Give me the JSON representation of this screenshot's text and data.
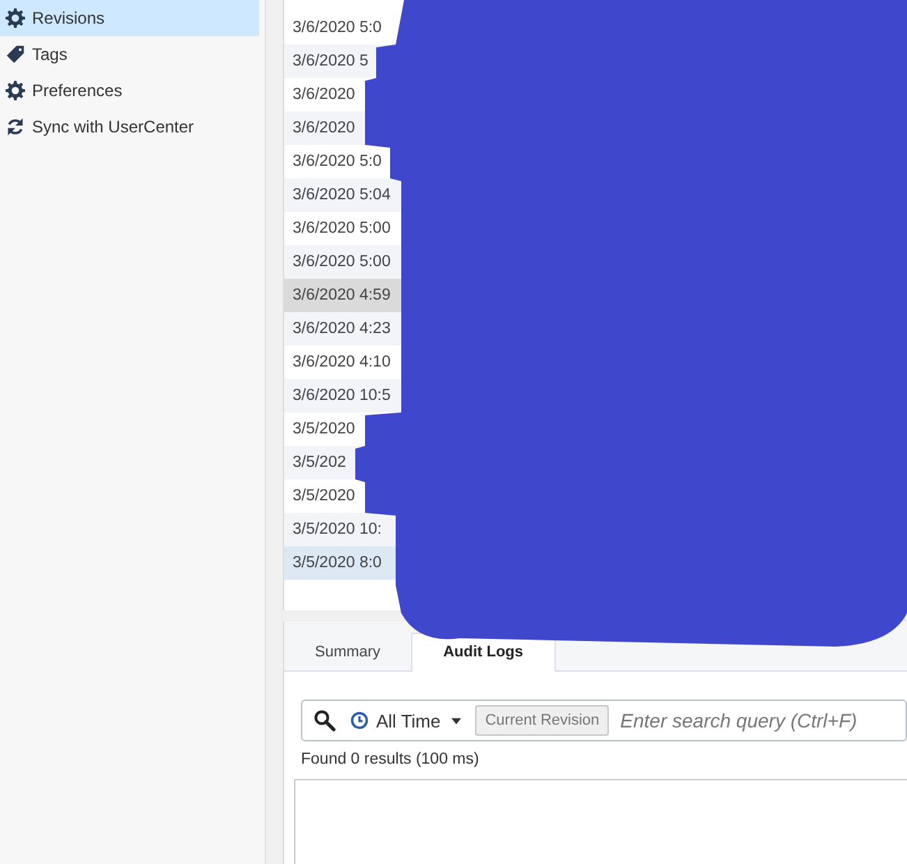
{
  "sidebar": {
    "items": [
      {
        "label": "Revisions",
        "selected": true
      },
      {
        "label": "Tags",
        "selected": false
      },
      {
        "label": "Preferences",
        "selected": false
      },
      {
        "label": "Sync with UserCenter",
        "selected": false
      }
    ]
  },
  "revisions": {
    "rows": [
      {
        "date": "3/6/2020 5:0",
        "selected": false,
        "hovered": false
      },
      {
        "date": "3/6/2020 5",
        "selected": false,
        "hovered": false
      },
      {
        "date": "3/6/2020",
        "selected": false,
        "hovered": false
      },
      {
        "date": "3/6/2020",
        "selected": false,
        "hovered": false
      },
      {
        "date": "3/6/2020 5:0",
        "selected": false,
        "hovered": false
      },
      {
        "date": "3/6/2020 5:04",
        "selected": false,
        "hovered": false
      },
      {
        "date": "3/6/2020 5:00",
        "selected": false,
        "hovered": false
      },
      {
        "date": "3/6/2020 5:00",
        "selected": false,
        "hovered": false
      },
      {
        "date": "3/6/2020 4:59",
        "selected": true,
        "hovered": false
      },
      {
        "date": "3/6/2020 4:23",
        "selected": false,
        "hovered": false
      },
      {
        "date": "3/6/2020 4:10",
        "selected": false,
        "hovered": false
      },
      {
        "date": "3/6/2020 10:5",
        "selected": false,
        "hovered": false
      },
      {
        "date": "3/5/2020",
        "selected": false,
        "hovered": false
      },
      {
        "date": "3/5/202",
        "selected": false,
        "hovered": false
      },
      {
        "date": "3/5/2020",
        "selected": false,
        "hovered": false
      },
      {
        "date": "3/5/2020 10:",
        "selected": false,
        "hovered": false
      },
      {
        "date": "3/5/2020 8:0",
        "selected": false,
        "hovered": true
      }
    ]
  },
  "details": {
    "tabs": [
      {
        "label": "Summary",
        "selected": false
      },
      {
        "label": "Audit Logs",
        "selected": true
      }
    ],
    "time_filter": "All Time",
    "scope_button": "Current Revision",
    "search": {
      "placeholder": "Enter search query (Ctrl+F)"
    },
    "result_summary": "Found 0 results (100 ms)"
  }
}
